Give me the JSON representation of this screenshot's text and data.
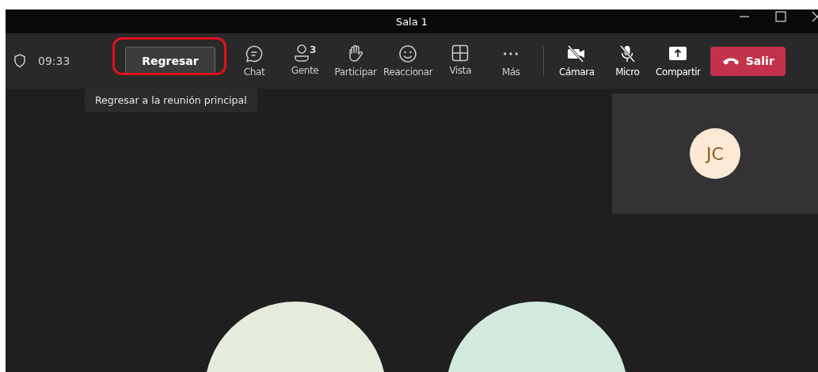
{
  "window": {
    "title": "Sala 1"
  },
  "toolbar": {
    "time": "09:33",
    "back_button": {
      "label": "Regresar",
      "highlighted": true
    },
    "tooltip": "Regresar a la reunión principal",
    "actions": [
      {
        "kind": "chat",
        "label": "Chat"
      },
      {
        "kind": "people",
        "label": "Gente",
        "count": "3"
      },
      {
        "kind": "hand",
        "label": "Participar"
      },
      {
        "kind": "react",
        "label": "Reaccionar"
      },
      {
        "kind": "view",
        "label": "Vista"
      },
      {
        "kind": "more",
        "label": "Más"
      }
    ],
    "devices": [
      {
        "kind": "camera",
        "label": "Cámara",
        "off": true
      },
      {
        "kind": "mic",
        "label": "Micro",
        "off": true
      },
      {
        "kind": "share",
        "label": "Compartir"
      }
    ],
    "leave_button": {
      "label": "Salir"
    }
  },
  "tile": {
    "initials": "JC"
  },
  "participants": [
    {
      "color": "#e6ecdc"
    },
    {
      "color": "#d1eadd"
    }
  ]
}
